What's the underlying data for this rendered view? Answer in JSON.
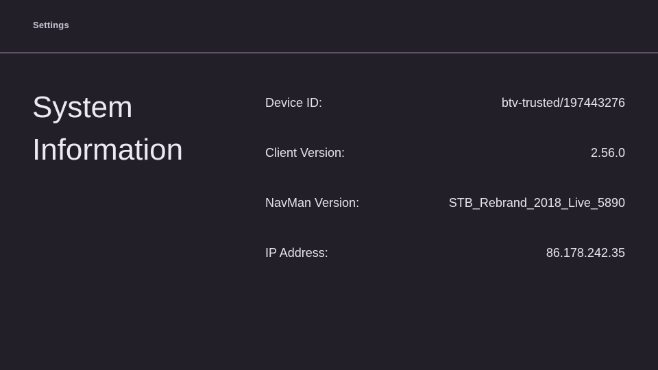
{
  "header": {
    "breadcrumb": "Settings"
  },
  "page": {
    "title_line1": "System",
    "title_line2": "Information"
  },
  "info": {
    "rows": [
      {
        "label": "Device ID:",
        "value": "btv-trusted/197443276"
      },
      {
        "label": "Client Version:",
        "value": "2.56.0"
      },
      {
        "label": "NavMan Version:",
        "value": "STB_Rebrand_2018_Live_5890"
      },
      {
        "label": "IP Address:",
        "value": "86.178.242.35"
      }
    ]
  },
  "colors": {
    "background": "#231f28",
    "divider": "#5a5463",
    "text": "#e6e3eb"
  }
}
